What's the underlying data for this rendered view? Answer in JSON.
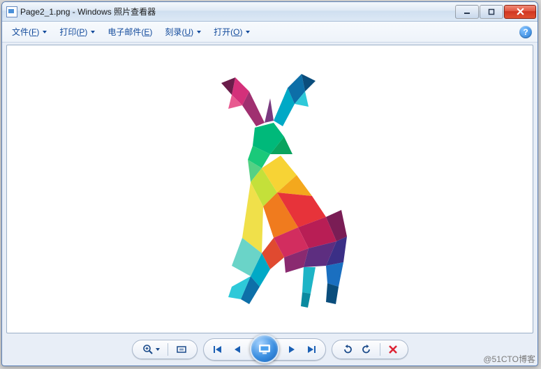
{
  "title": "Page2_1.png - Windows 照片查看器",
  "menubar": {
    "file": {
      "label": "文件",
      "key": "F"
    },
    "print": {
      "label": "打印",
      "key": "P"
    },
    "email": {
      "label": "电子邮件",
      "key": "E"
    },
    "burn": {
      "label": "刻录",
      "key": "U"
    },
    "open": {
      "label": "打开",
      "key": "O"
    }
  },
  "help_glyph": "?",
  "watermark": "@51CTO博客"
}
